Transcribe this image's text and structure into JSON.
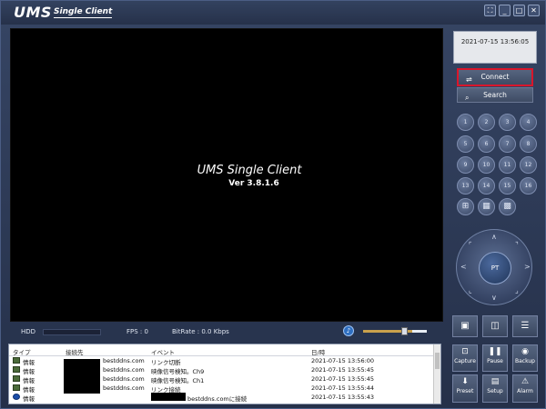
{
  "app": {
    "logo": "UMS",
    "logo_sub": "Single Client",
    "window_buttons": [
      "⛶",
      "_",
      "□",
      "✕"
    ]
  },
  "video": {
    "splash_title": "UMS Single Client",
    "splash_version": "Ver 3.8.1.6"
  },
  "status": {
    "hdd_label": "HDD",
    "fps": "FPS :  0",
    "bitrate": "BitRate :  0.0 Kbps"
  },
  "log": {
    "headers": [
      "タイプ",
      "接続先",
      "イベント",
      "日/時"
    ],
    "rows": [
      {
        "type": "情報",
        "dest": "bestddns.com",
        "event": "リンク切断",
        "time": "2021-07-15 13:56:00"
      },
      {
        "type": "情報",
        "dest": "bestddns.com",
        "event": "映像信号検知。Ch9",
        "time": "2021-07-15 13:55:45"
      },
      {
        "type": "情報",
        "dest": "bestddns.com",
        "event": "映像信号検知。Ch1",
        "time": "2021-07-15 13:55:45"
      },
      {
        "type": "情報",
        "dest": "bestddns.com",
        "event": "リンク接続",
        "time": "2021-07-15 13:55:44"
      },
      {
        "type": "情報",
        "dest": "",
        "event": "bestddns.comに接続",
        "time": "2021-07-15 13:55:43"
      }
    ]
  },
  "panel": {
    "clock": "2021-07-15 13:56:05",
    "connect_label": "Connect",
    "search_label": "Search",
    "channels": [
      "1",
      "2",
      "3",
      "4",
      "5",
      "6",
      "7",
      "8",
      "9",
      "10",
      "11",
      "12",
      "13",
      "14",
      "15",
      "16"
    ],
    "layout_icons": [
      "grid-2x2-icon",
      "grid-3x3-icon",
      "grid-4x4-icon"
    ],
    "ptz_label": "PT",
    "view_buttons": [
      "single-view-icon",
      "split-view-icon",
      "list-view-icon"
    ],
    "actions": [
      {
        "label": "Capture",
        "icon": "capture-icon"
      },
      {
        "label": "Pause",
        "icon": "pause-icon"
      },
      {
        "label": "Backup",
        "icon": "backup-icon"
      },
      {
        "label": "Preset",
        "icon": "preset-icon"
      },
      {
        "label": "Setup",
        "icon": "setup-icon"
      },
      {
        "label": "Alarm",
        "icon": "alarm-icon"
      }
    ],
    "highlight_color": "#d9162b"
  }
}
